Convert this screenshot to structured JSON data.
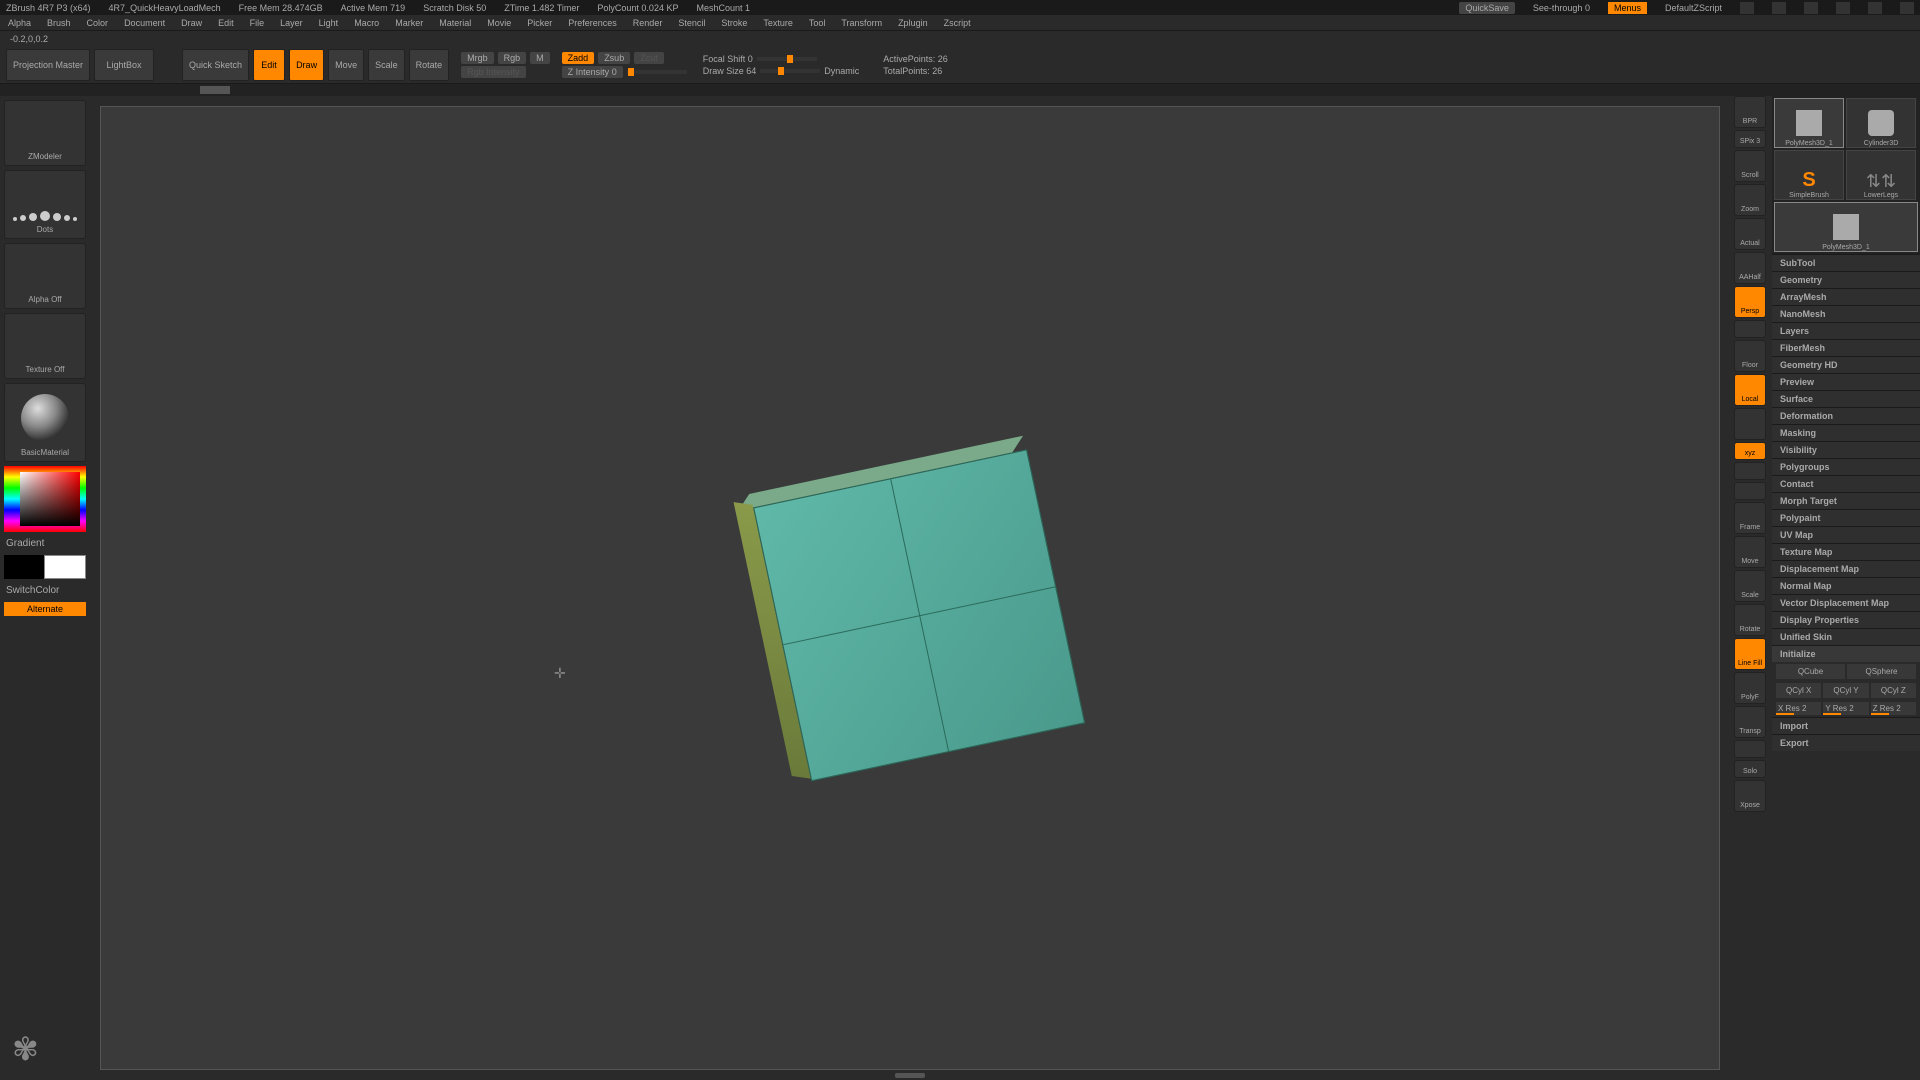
{
  "titlebar": {
    "app": "ZBrush 4R7 P3 (x64)",
    "project": "4R7_QuickHeavyLoadMech",
    "stats": [
      "Free Mem 28.474GB",
      "Active Mem 719",
      "Scratch Disk 50",
      "ZTime 1.482 Timer",
      "PolyCount 0.024 KP",
      "MeshCount 1"
    ],
    "quicksave": "QuickSave",
    "seethrough": "See-through  0",
    "menus": "Menus",
    "script": "DefaultZScript"
  },
  "menus": [
    "Alpha",
    "Brush",
    "Color",
    "Document",
    "Draw",
    "Edit",
    "File",
    "Layer",
    "Light",
    "Macro",
    "Marker",
    "Material",
    "Movie",
    "Picker",
    "Preferences",
    "Render",
    "Stencil",
    "Stroke",
    "Texture",
    "Tool",
    "Transform",
    "Zplugin",
    "Zscript"
  ],
  "status": "-0.2,0,0.2",
  "toolbar": {
    "projection": "Projection Master",
    "lightbox": "LightBox",
    "quicksketch": "Quick Sketch",
    "edit": "Edit",
    "draw": "Draw",
    "move": "Move",
    "scale": "Scale",
    "rotate": "Rotate",
    "mrgb": "Mrgb",
    "rgb": "Rgb",
    "m": "M",
    "rgbint": "Rgb Intensity",
    "zadd": "Zadd",
    "zsub": "Zsub",
    "zcut": "Zcut",
    "zint": "Z Intensity 0",
    "focal": "Focal Shift 0",
    "drawsize": "Draw Size 64",
    "dynamic": "Dynamic",
    "active": "ActivePoints: 26",
    "total": "TotalPoints: 26"
  },
  "left": {
    "zmodeler": "ZModeler",
    "dots": "Dots",
    "alpha": "Alpha  Off",
    "texture": "Texture  Off",
    "material": "BasicMaterial",
    "gradient": "Gradient",
    "switchcolor": "SwitchColor",
    "alternate": "Alternate"
  },
  "viewport_icons": [
    "BPR",
    "SPix 3",
    "Scroll",
    "Zoom",
    "Actual",
    "AAHalf",
    "Persp",
    "",
    "Floor",
    "Local",
    "",
    "xyz",
    "",
    "",
    "Frame",
    "Move",
    "Scale",
    "Rotate",
    "Line Fill",
    "PolyF",
    "Transp",
    "",
    "Solo",
    "Xpose"
  ],
  "tools": [
    "PolyMesh3D_1",
    "Cylinder3D",
    "SimpleBrush",
    "LowerLegs",
    "PolyMesh3D_1"
  ],
  "panels": [
    "SubTool",
    "Geometry",
    "ArrayMesh",
    "NanoMesh",
    "Layers",
    "FiberMesh",
    "Geometry HD",
    "Preview",
    "Surface",
    "Deformation",
    "Masking",
    "Visibility",
    "Polygroups",
    "Contact",
    "Morph Target",
    "Polypaint",
    "UV Map",
    "Texture Map",
    "Displacement Map",
    "Normal Map",
    "Vector Displacement Map",
    "Display Properties",
    "Unified Skin",
    "Initialize",
    "Import",
    "Export"
  ],
  "initialize": {
    "qcube": "QCube",
    "qsphere": "QSphere",
    "qcylx": "QCyl X",
    "qcyly": "QCyl Y",
    "qcylz": "QCyl Z",
    "xres": "X Res 2",
    "yres": "Y Res 2",
    "zres": "Z Res 2"
  }
}
